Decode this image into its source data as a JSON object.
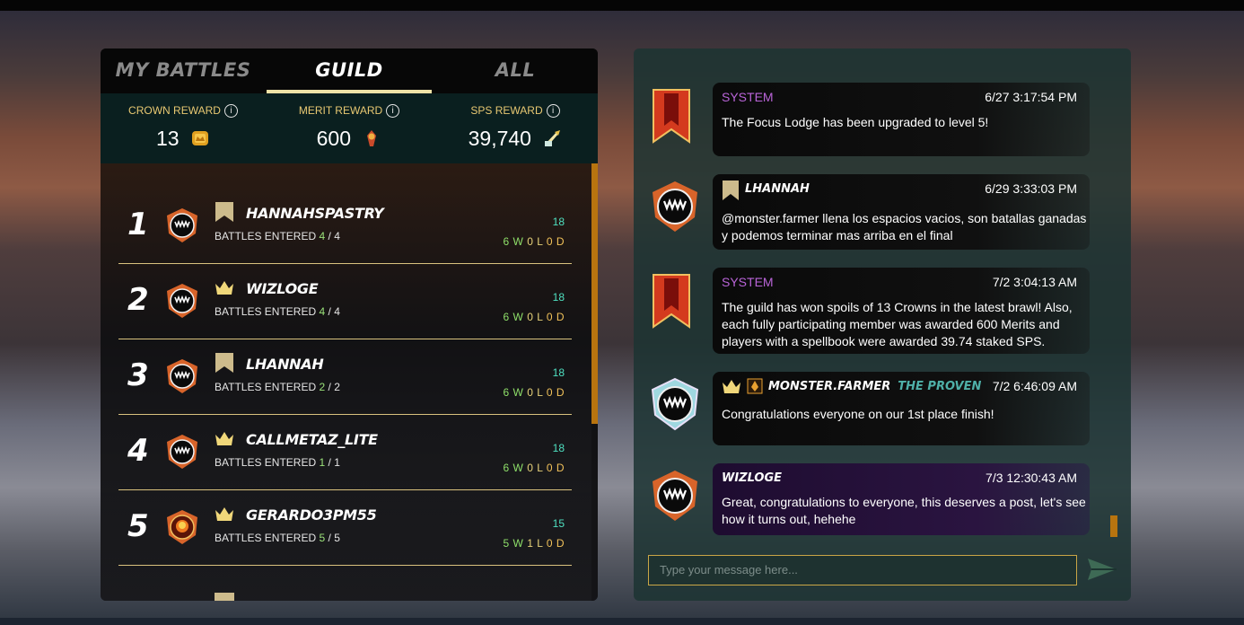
{
  "tabs": {
    "my_battles": "MY BATTLES",
    "guild": "GUILD",
    "all": "ALL",
    "active": "GUILD"
  },
  "rewards": {
    "crown": {
      "label": "CROWN REWARD",
      "value": "13",
      "icon": "crown-coin-icon"
    },
    "merit": {
      "label": "MERIT REWARD",
      "value": "600",
      "icon": "merit-icon"
    },
    "sps": {
      "label": "SPS REWARD",
      "value": "39,740",
      "icon": "sps-icon"
    },
    "info_glyph": "i"
  },
  "colors": {
    "accent": "#efe2a6",
    "gold": "#e8c872",
    "system": "#b964d8",
    "teal": "#4fe0c0",
    "scroll": "#b8740f"
  },
  "players": [
    {
      "rank": "1",
      "name": "HANNAHSPASTRY",
      "badge": "banner-icon",
      "battles_label": "BATTLES ENTERED",
      "entered": "4",
      "total": "4",
      "score": "18",
      "w": "6 W",
      "l": "0 L",
      "d": "0 D"
    },
    {
      "rank": "2",
      "name": "WIZLOGE",
      "badge": "crown-icon",
      "battles_label": "BATTLES ENTERED",
      "entered": "4",
      "total": "4",
      "score": "18",
      "w": "6 W",
      "l": "0 L",
      "d": "0 D"
    },
    {
      "rank": "3",
      "name": "LHANNAH",
      "badge": "banner-icon",
      "battles_label": "BATTLES ENTERED",
      "entered": "2",
      "total": "2",
      "score": "18",
      "w": "6 W",
      "l": "0 L",
      "d": "0 D"
    },
    {
      "rank": "4",
      "name": "CALLMETAZ_LITE",
      "badge": "crown-icon",
      "battles_label": "BATTLES ENTERED",
      "entered": "1",
      "total": "1",
      "score": "18",
      "w": "6 W",
      "l": "0 L",
      "d": "0 D"
    },
    {
      "rank": "5",
      "name": "GERARDO3PM55",
      "badge": "crown-icon",
      "battles_label": "BATTLES ENTERED",
      "entered": "5",
      "total": "5",
      "score": "15",
      "w": "5 W",
      "l": "1 L",
      "d": "0 D"
    }
  ],
  "messages": [
    {
      "sender": "SYSTEM",
      "time": "6/27 3:17:54 PM",
      "text": "The Focus Lodge has been upgraded to level 5!",
      "type": "system"
    },
    {
      "sender": "LHANNAH",
      "time": "6/29 3:33:03 PM",
      "text": "@monster.farmer llena los espacios vacios, son batallas ganadas y podemos terminar mas arriba en el final",
      "type": "user"
    },
    {
      "sender": "SYSTEM",
      "time": "7/2 3:04:13 AM",
      "text": "The guild has won spoils of 13 Crowns in the latest brawl! Also, each fully participating member was awarded 600 Merits and players with a spellbook were awarded 39.74 staked SPS.",
      "type": "system"
    },
    {
      "sender": "MONSTER.FARMER",
      "title": "THE PROVEN",
      "time": "7/2 6:46:09 AM",
      "text": "Congratulations everyone on our 1st place finish!",
      "type": "user"
    },
    {
      "sender": "WIZLOGE",
      "time": "7/3 12:30:43 AM",
      "text": "Great, congratulations to everyone, this deserves a post, let's see how it turns out, hehehe",
      "type": "user"
    }
  ],
  "chat": {
    "placeholder": "Type your message here...",
    "send_icon": "send-icon"
  }
}
